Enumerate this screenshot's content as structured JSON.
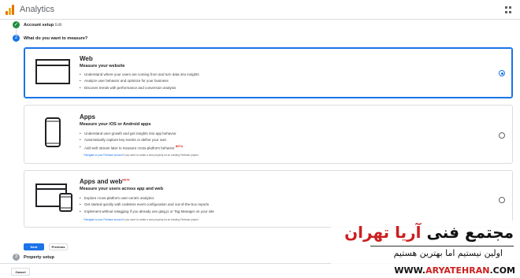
{
  "app": {
    "title": "Analytics"
  },
  "stepper": {
    "step1": {
      "label": "Account setup",
      "edit": "Edit",
      "marker": "✓"
    },
    "step2": {
      "label": "What do you want to measure?",
      "number": "2"
    },
    "step3": {
      "label": "Property setup",
      "number": "3"
    }
  },
  "options": [
    {
      "title": "Web",
      "subtitle": "Measure your website",
      "icon": "browser-window-icon",
      "selected": true,
      "bullets": [
        "Understand where your users are coming from and turn data into insights",
        "Analyze user behavior and optimize for your business",
        "Discover trends with performance and conversion analysis"
      ]
    },
    {
      "title": "Apps",
      "subtitle": "Measure your iOS or Android apps",
      "icon": "phone-icon",
      "selected": false,
      "bullets": [
        "Understand user growth and get insights into app behavior",
        "Automatically capture key events or define your own",
        "Add web stream later to measure cross-platform behavior"
      ],
      "beta": "BETA",
      "note_link": "*Navigate to your Firebase account",
      "note_text": " if you want to create a new property for an existing Firebase project"
    },
    {
      "title": "Apps and web",
      "subtitle": "Measure your users across app and web",
      "icon": "browser-and-phone-icon",
      "selected": false,
      "beta": "BETA",
      "bullets": [
        "Explore cross-platform user-centric analytics",
        "Get started quickly with codeless event configuration and out-of-the-box reports",
        "Implement without retagging if you already use gtag.js or Tag Manager on your site"
      ],
      "note_link": "*Navigate to your Firebase account",
      "note_text": " if you want to create a new property for an existing Firebase project"
    }
  ],
  "buttons": {
    "next": "Next",
    "previous": "Previous",
    "cancel": "Cancel"
  },
  "watermark": {
    "title_red": "آریا تهران",
    "title_black": "مجتمع فنی ",
    "slogan": "اولین نیستیم اما بهترین هستیم",
    "site_prefix": "WWW.",
    "site_brand": "ARYATEHRAN",
    "site_suffix": ".COM"
  },
  "colors": {
    "accent": "#1a73e8",
    "success": "#1e8e3e",
    "brand_red": "#cc1f1f"
  }
}
